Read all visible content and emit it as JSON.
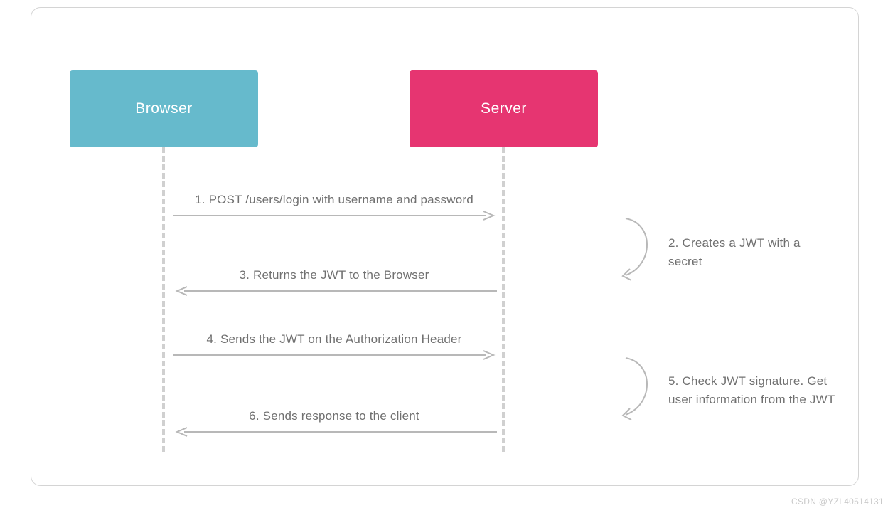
{
  "actors": {
    "browser": "Browser",
    "server": "Server"
  },
  "steps": {
    "s1": "1. POST /users/login with username and password",
    "s2": "2. Creates a JWT with a secret",
    "s3": "3. Returns the JWT to the Browser",
    "s4": "4. Sends the JWT on the Authorization Header",
    "s5": "5. Check JWT signature. Get user information from the JWT",
    "s6": "6. Sends response to the client"
  },
  "watermark": "CSDN @YZL40514131",
  "colors": {
    "browser": "#66bacc",
    "server": "#e63571",
    "text": "#707070",
    "line": "#b8b8b8"
  },
  "chart_data": {
    "type": "table",
    "description": "JWT authentication sequence diagram between Browser and Server",
    "participants": [
      "Browser",
      "Server"
    ],
    "messages": [
      {
        "from": "Browser",
        "to": "Server",
        "label": "1. POST /users/login with username and password"
      },
      {
        "from": "Server",
        "to": "Server",
        "label": "2. Creates a JWT with a secret"
      },
      {
        "from": "Server",
        "to": "Browser",
        "label": "3. Returns the JWT to the Browser"
      },
      {
        "from": "Browser",
        "to": "Server",
        "label": "4. Sends the JWT on the Authorization Header"
      },
      {
        "from": "Server",
        "to": "Server",
        "label": "5. Check JWT signature. Get user information from the JWT"
      },
      {
        "from": "Server",
        "to": "Browser",
        "label": "6. Sends response to the client"
      }
    ]
  }
}
